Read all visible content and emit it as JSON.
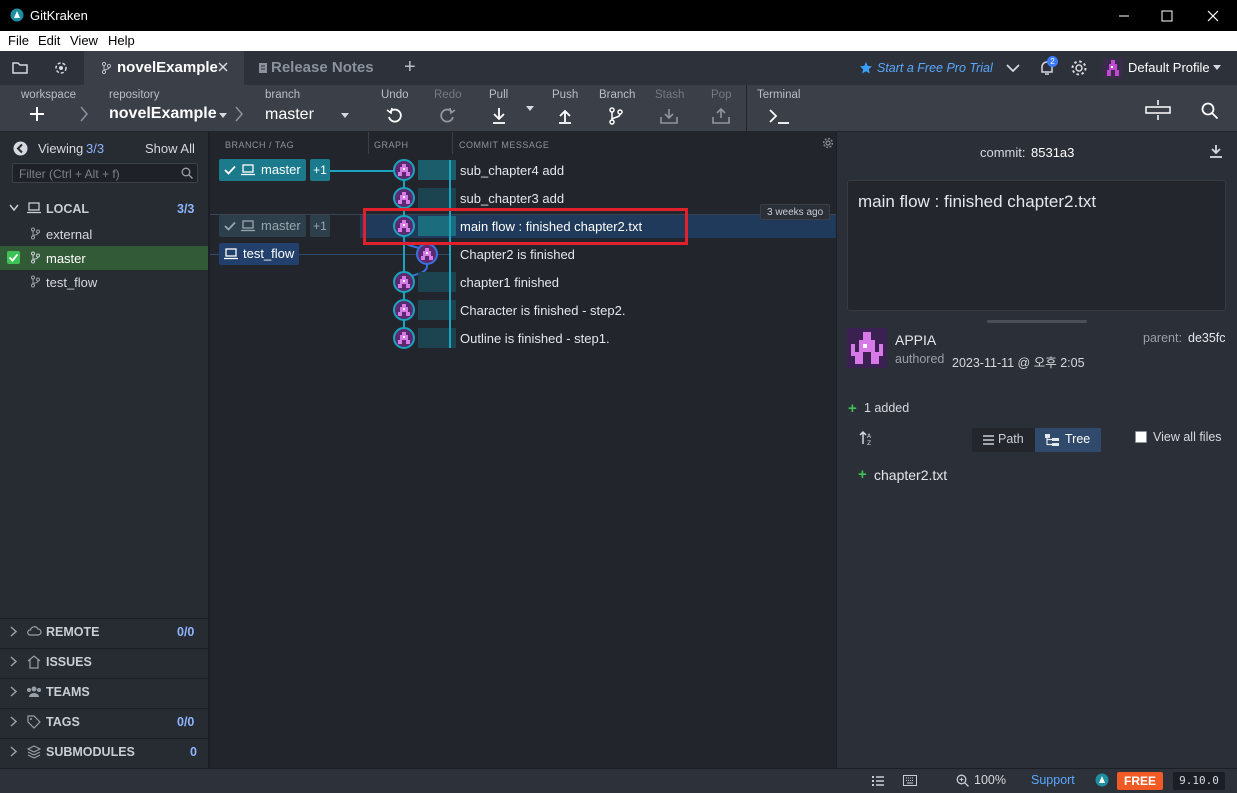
{
  "window": {
    "title": "GitKraken"
  },
  "menu": {
    "file": "File",
    "edit": "Edit",
    "view": "View",
    "help": "Help"
  },
  "tabs": {
    "active": "novelExample",
    "release_notes": "Release Notes",
    "new_tab": "+"
  },
  "header_right": {
    "pro_trial": "Start a Free Pro Trial",
    "notifications_count": "2",
    "profile": "Default Profile"
  },
  "toolbar": {
    "workspace_label": "workspace",
    "repository_label": "repository",
    "repository_name": "novelExample",
    "branch_label": "branch",
    "branch_name": "master",
    "undo": "Undo",
    "redo": "Redo",
    "pull": "Pull",
    "push": "Push",
    "branch": "Branch",
    "stash": "Stash",
    "pop": "Pop",
    "terminal": "Terminal"
  },
  "sidebar": {
    "viewing_label": "Viewing",
    "viewing_count": "3/3",
    "show_all": "Show All",
    "filter_placeholder": "Filter (Ctrl + Alt + f)",
    "local": {
      "title": "LOCAL",
      "count": "3/3"
    },
    "branches": [
      "external",
      "master",
      "test_flow"
    ],
    "sections": [
      {
        "title": "REMOTE",
        "count": "0/0"
      },
      {
        "title": "ISSUES",
        "count": ""
      },
      {
        "title": "TEAMS",
        "count": ""
      },
      {
        "title": "TAGS",
        "count": "0/0"
      },
      {
        "title": "SUBMODULES",
        "count": "0"
      }
    ]
  },
  "graph": {
    "columns": {
      "branch_tag": "BRANCH / TAG",
      "graph": "GRAPH",
      "commit_message": "COMMIT MESSAGE"
    },
    "badges": {
      "master_top": "master",
      "plus_one": "+1",
      "master_mid": "master",
      "test_flow": "test_flow"
    },
    "tooltip": "3 weeks ago",
    "commits": [
      "sub_chapter4 add",
      "sub_chapter3 add",
      "main flow : finished chapter2.txt",
      "Chapter2 is finished",
      "chapter1 finished",
      "Character is finished - step2.",
      "Outline is finished - step1."
    ]
  },
  "detail": {
    "commit_label": "commit:",
    "commit_sha": "8531a3",
    "message": "main flow : finished chapter2.txt",
    "author": "APPIA",
    "authored_label": "authored",
    "authored_date": "2023-11-11 @ 오후 2:05",
    "parent_label": "parent:",
    "parent_sha": "de35fc",
    "added": "1 added",
    "path_btn": "Path",
    "tree_btn": "Tree",
    "view_all": "View all files",
    "file": "chapter2.txt"
  },
  "status": {
    "zoom": "100%",
    "support": "Support",
    "free": "FREE",
    "version": "9.10.0"
  },
  "colors": {
    "accent_teal": "#1e8ea1",
    "selected_row": "#1f3a5a",
    "highlight_red": "#e0202a",
    "link_blue": "#5aa7ff",
    "free_orange": "#f15a24"
  }
}
